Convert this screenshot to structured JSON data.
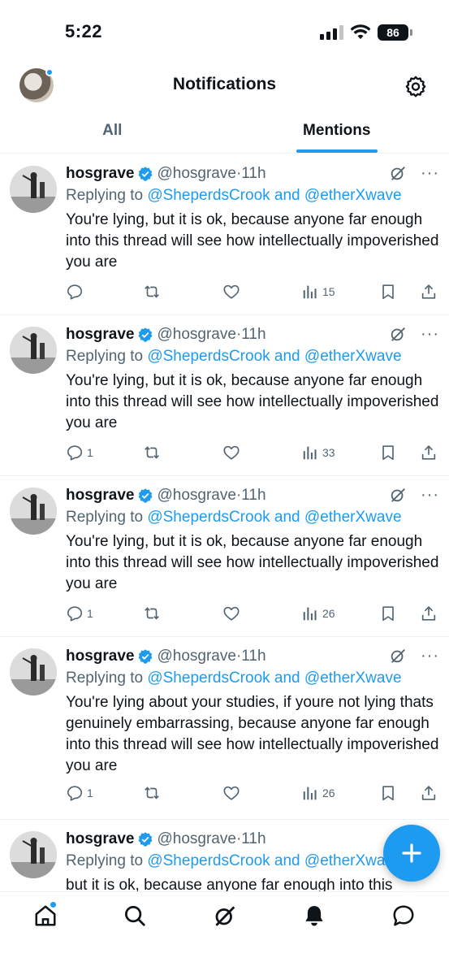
{
  "status_bar": {
    "time": "5:22",
    "battery": "86"
  },
  "header": {
    "title": "Notifications"
  },
  "tabs": [
    {
      "label": "All",
      "active": false
    },
    {
      "label": "Mentions",
      "active": true
    }
  ],
  "tweets": [
    {
      "name": "hosgrave",
      "handle": "@hosgrave",
      "sep": "·",
      "time": "11h",
      "replying_prefix": "Replying to ",
      "replying_to": "@SheperdsCrook and @etherXwave",
      "text": "You're lying, but it is ok, because anyone far enough into this thread will see how intellectually impoverished you are",
      "replies": "",
      "views": "15"
    },
    {
      "name": "hosgrave",
      "handle": "@hosgrave",
      "sep": "·",
      "time": "11h",
      "replying_prefix": "Replying to ",
      "replying_to": "@SheperdsCrook and @etherXwave",
      "text": "You're lying, but it is ok, because anyone far enough into this thread will see how intellectually impoverished you are",
      "replies": "1",
      "views": "33"
    },
    {
      "name": "hosgrave",
      "handle": "@hosgrave",
      "sep": "·",
      "time": "11h",
      "replying_prefix": "Replying to ",
      "replying_to": "@SheperdsCrook and @etherXwave",
      "text": "You're lying, but it is ok, because anyone far enough into this thread will see how intellectually impoverished you are",
      "replies": "1",
      "views": "26"
    },
    {
      "name": "hosgrave",
      "handle": "@hosgrave",
      "sep": "·",
      "time": "11h",
      "replying_prefix": "Replying to ",
      "replying_to": "@SheperdsCrook and @etherXwave",
      "text": "You're lying about your studies, if youre not lying thats genuinely embarrassing, because anyone far enough into this thread will see how intellectually impoverished you are",
      "replies": "1",
      "views": "26"
    },
    {
      "name": "hosgrave",
      "handle": "@hosgrave",
      "sep": "·",
      "time": "11h",
      "replying_prefix": "Replying to ",
      "replying_to": "@SheperdsCrook and @etherXwave",
      "text": "but it is ok, because anyone far enough into this",
      "replies": "",
      "views": ""
    }
  ],
  "icons": {
    "settings": "gear-icon",
    "verified": "verified-badge-icon",
    "grok": "grok-icon",
    "more": "more-icon",
    "reply": "reply-icon",
    "retweet": "retweet-icon",
    "like": "like-icon",
    "views": "views-icon",
    "bookmark": "bookmark-icon",
    "share": "share-icon",
    "compose": "plus-icon",
    "nav": [
      "home-icon",
      "search-icon",
      "grok-icon",
      "bell-icon",
      "messages-icon"
    ]
  },
  "colors": {
    "accent": "#1d9bf0",
    "text": "#0f1419",
    "muted": "#536471"
  }
}
